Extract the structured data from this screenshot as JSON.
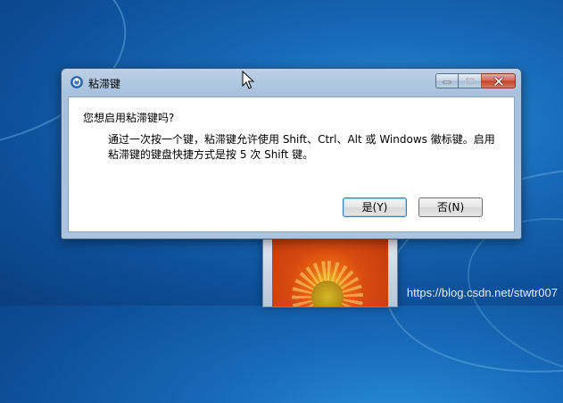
{
  "dialog": {
    "title": "粘滞键",
    "icon": "sticky-keys-icon",
    "prompt": "您想启用粘滞键吗?",
    "detail_line1": "通过一次按一个键，粘滞键允许使用 Shift、Ctrl、Alt 或 Windows 徽标键。启用",
    "detail_line2": "粘滞键的键盘快捷方式是按 5 次 Shift 键。",
    "buttons": {
      "yes": "是(Y)",
      "no": "否(N)"
    },
    "caption_buttons": [
      "minimize-icon",
      "maximize-icon",
      "close-icon"
    ]
  },
  "desktop": {
    "watermark": "https://blog.csdn.net/stwtr007"
  },
  "colors": {
    "desktop_blue": "#1769b8",
    "close_red": "#c2412a",
    "default_button_border": "#3c7fb1"
  }
}
